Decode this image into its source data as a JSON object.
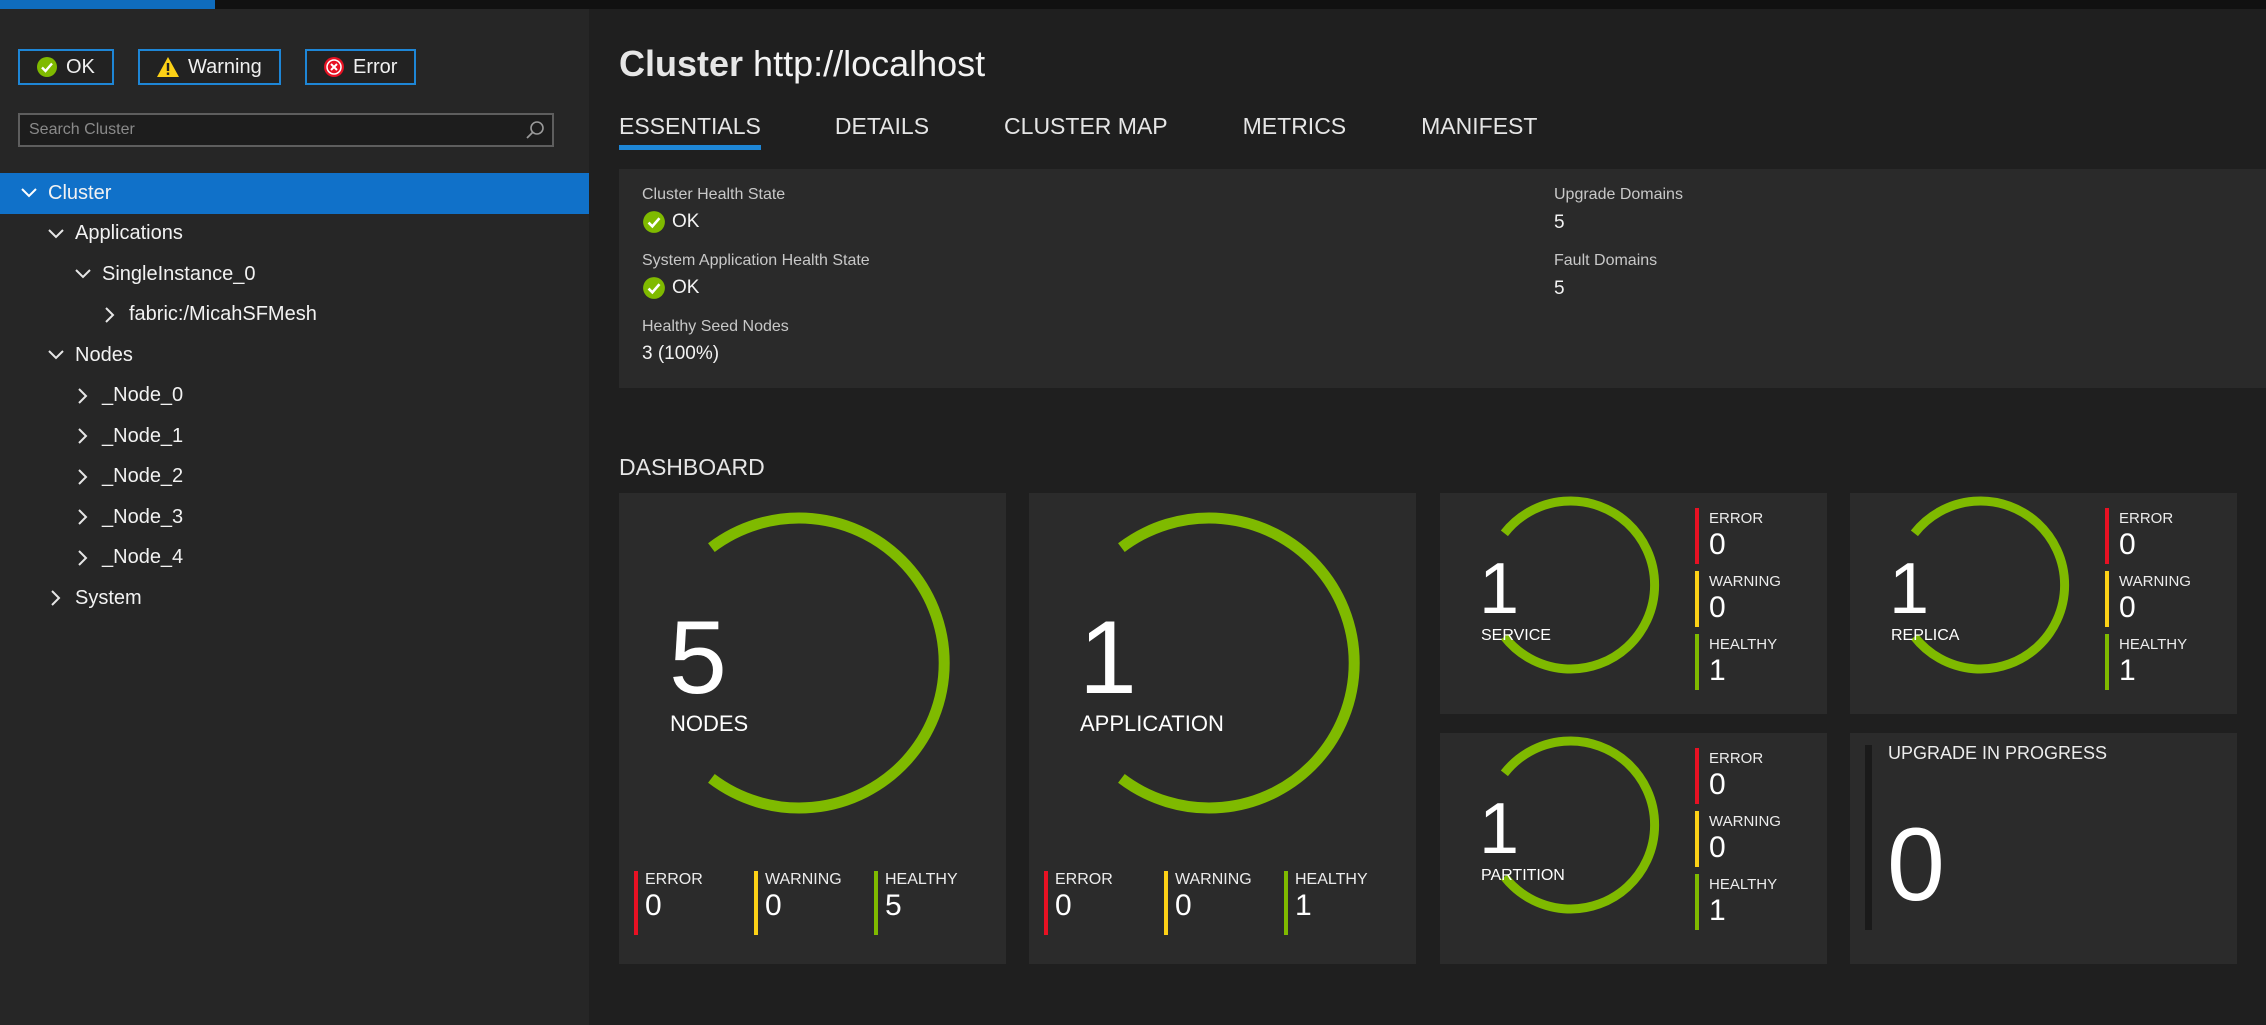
{
  "colors": {
    "accent": "#1071c9",
    "ok": "#7fba00",
    "warning": "#fcd116",
    "error": "#e81123"
  },
  "filters": {
    "ok_label": "OK",
    "warning_label": "Warning",
    "error_label": "Error"
  },
  "search": {
    "placeholder": "Search Cluster"
  },
  "tree": {
    "cluster": "Cluster",
    "applications": "Applications",
    "single_instance": "SingleInstance_0",
    "service": "fabric:/MicahSFMesh",
    "nodes": "Nodes",
    "node_items": [
      "_Node_0",
      "_Node_1",
      "_Node_2",
      "_Node_3",
      "_Node_4"
    ],
    "system": "System"
  },
  "header": {
    "title_bold": "Cluster",
    "title_rest": "http://localhost"
  },
  "tabs": [
    "ESSENTIALS",
    "DETAILS",
    "CLUSTER MAP",
    "METRICS",
    "MANIFEST"
  ],
  "essentials": {
    "cluster_health_label": "Cluster Health State",
    "cluster_health_value": "OK",
    "sys_app_health_label": "System Application Health State",
    "sys_app_health_value": "OK",
    "seed_nodes_label": "Healthy Seed Nodes",
    "seed_nodes_value": "3 (100%)",
    "upgrade_domains_label": "Upgrade Domains",
    "upgrade_domains_value": "5",
    "fault_domains_label": "Fault Domains",
    "fault_domains_value": "5"
  },
  "dashboard": {
    "heading": "DASHBOARD",
    "nodes": {
      "count": "5",
      "label": "NODES",
      "error_label": "ERROR",
      "error": "0",
      "warning_label": "WARNING",
      "warning": "0",
      "healthy_label": "HEALTHY",
      "healthy": "5"
    },
    "applications": {
      "count": "1",
      "label": "APPLICATION",
      "error_label": "ERROR",
      "error": "0",
      "warning_label": "WARNING",
      "warning": "0",
      "healthy_label": "HEALTHY",
      "healthy": "1"
    },
    "services": {
      "count": "1",
      "label": "SERVICE",
      "error_label": "ERROR",
      "error": "0",
      "warning_label": "WARNING",
      "warning": "0",
      "healthy_label": "HEALTHY",
      "healthy": "1"
    },
    "replicas": {
      "count": "1",
      "label": "REPLICA",
      "error_label": "ERROR",
      "error": "0",
      "warning_label": "WARNING",
      "warning": "0",
      "healthy_label": "HEALTHY",
      "healthy": "1"
    },
    "partitions": {
      "count": "1",
      "label": "PARTITION",
      "error_label": "ERROR",
      "error": "0",
      "warning_label": "WARNING",
      "warning": "0",
      "healthy_label": "HEALTHY",
      "healthy": "1"
    },
    "upgrade": {
      "label": "UPGRADE IN PROGRESS",
      "count": "0"
    }
  }
}
